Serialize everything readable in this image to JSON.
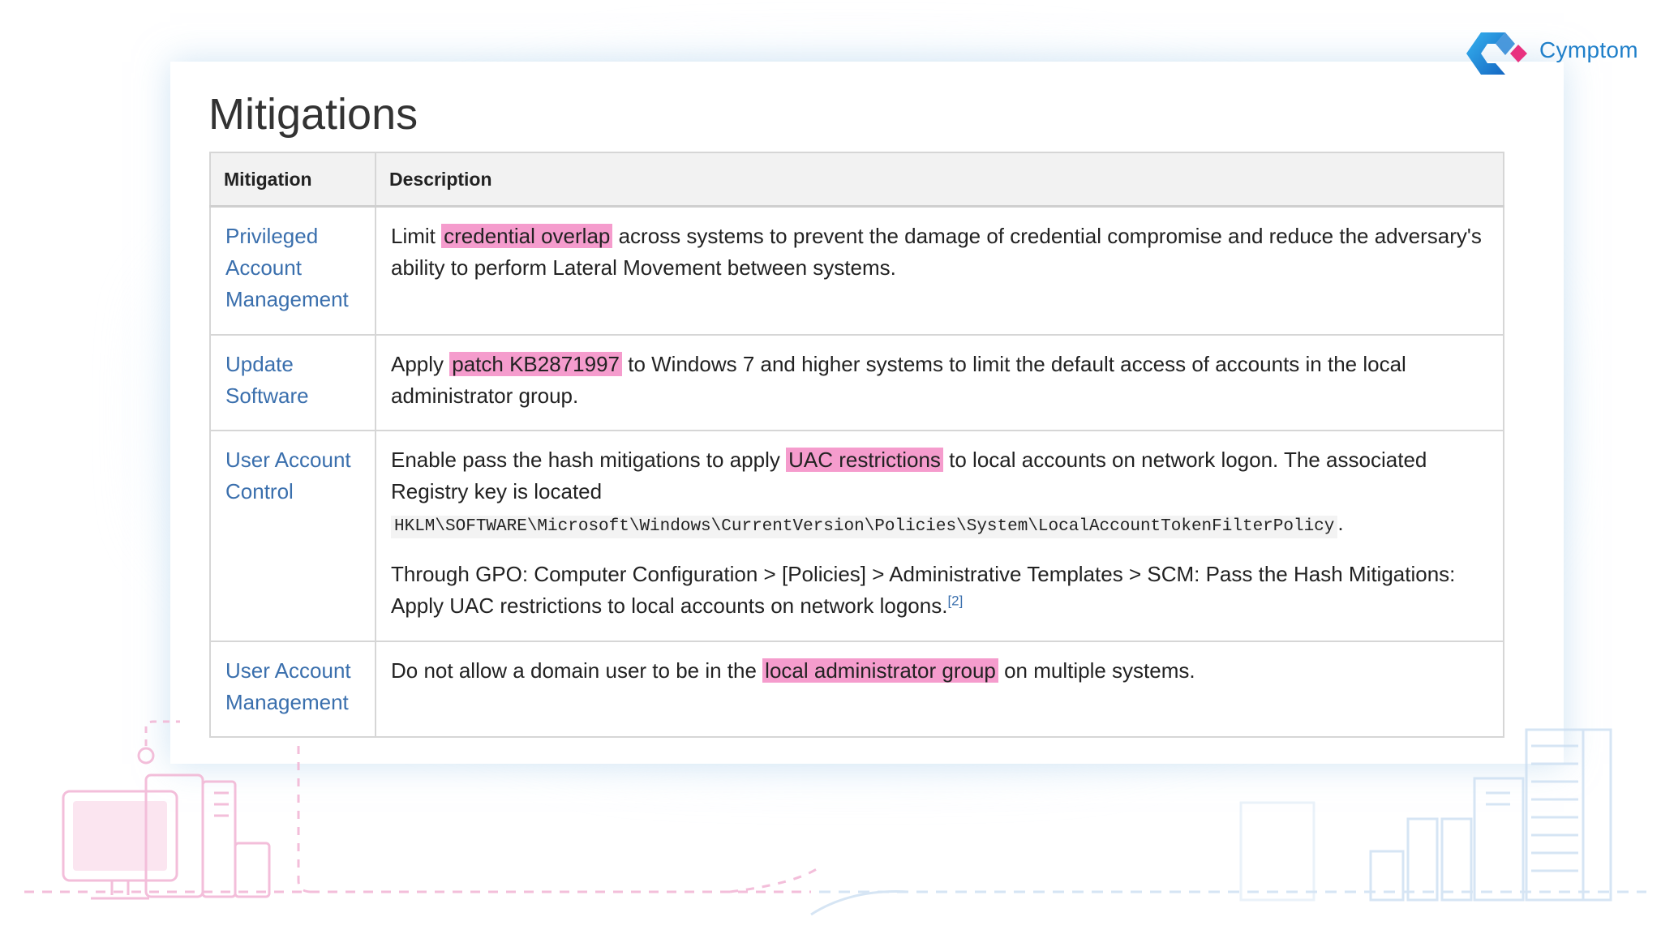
{
  "brand": {
    "name": "Cymptom"
  },
  "page": {
    "title": "Mitigations"
  },
  "table": {
    "headers": [
      "Mitigation",
      "Description"
    ],
    "rows": [
      {
        "name": "Privileged Account Management",
        "p1_a": "Limit ",
        "p1_hl": "credential overlap",
        "p1_b": " across systems to prevent the damage of credential compromise and reduce the adversary's ability to perform Lateral Movement between systems."
      },
      {
        "name": "Update Software",
        "p1_a": "Apply ",
        "p1_hl": "patch KB2871997",
        "p1_b": " to Windows 7 and higher systems to limit the default access of accounts in the local administrator group."
      },
      {
        "name": "User Account Control",
        "p1_a": "Enable pass the hash mitigations to apply ",
        "p1_hl": "UAC restrictions",
        "p1_b": " to local accounts on network logon. The associated Registry key is located ",
        "p1_code": "HKLM\\SOFTWARE\\Microsoft\\Windows\\CurrentVersion\\Policies\\System\\LocalAccountTokenFilterPolicy",
        "p1_end": ".",
        "p2": "Through GPO: Computer Configuration > [Policies] > Administrative Templates > SCM: Pass the Hash Mitigations: Apply UAC restrictions to local accounts on network logons.",
        "p2_ref": "[2]"
      },
      {
        "name": "User Account Management",
        "p1_a": "Do not allow a domain user to be in the ",
        "p1_hl": "local administrator group",
        "p1_b": " on multiple systems."
      }
    ]
  },
  "colors": {
    "highlight": "#f59ccd",
    "link": "#3a6fad",
    "brand_blue": "#1f7fc9",
    "brand_pink": "#e8317f"
  }
}
